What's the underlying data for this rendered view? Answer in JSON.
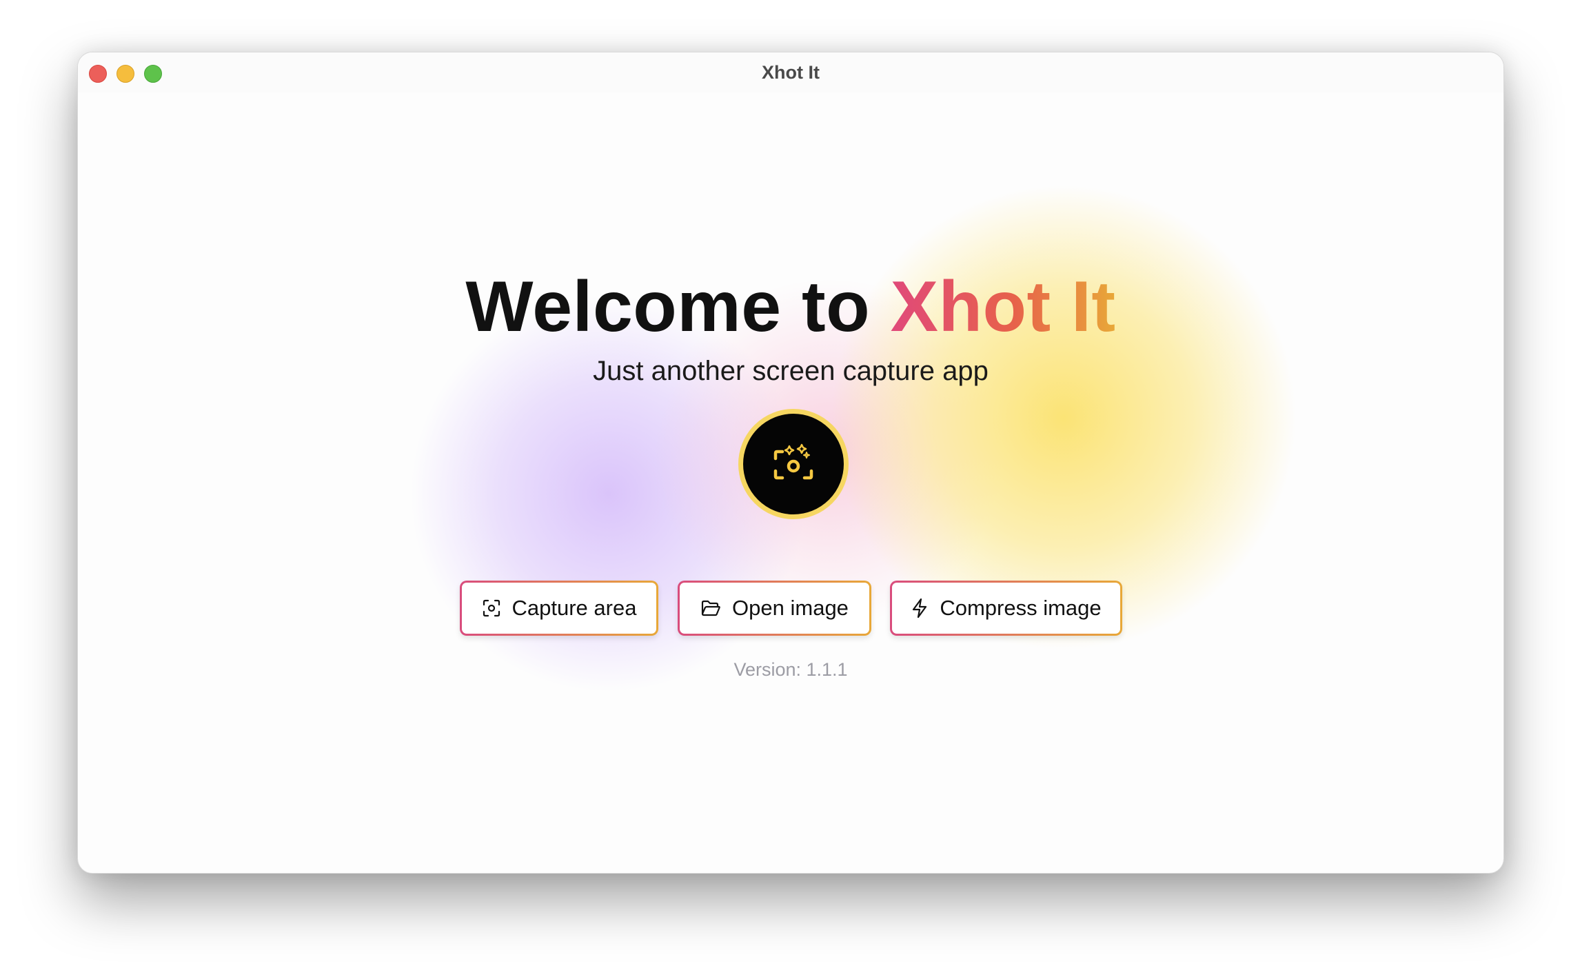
{
  "window": {
    "title": "Xhot It"
  },
  "hero": {
    "headline_prefix": "Welcome to",
    "headline_brand": "Xhot It",
    "subtitle": "Just another screen capture app",
    "logo_icon": "sparkle-camera-icon"
  },
  "actions": [
    {
      "label": "Capture area",
      "icon": "capture-area-icon"
    },
    {
      "label": "Open image",
      "icon": "folder-open-icon"
    },
    {
      "label": "Compress image",
      "icon": "lightning-icon"
    }
  ],
  "footer": {
    "version": "Version: 1.1.1"
  },
  "colors": {
    "brand_gradient_start": "#e0497a",
    "brand_gradient_end": "#e8a838",
    "logo_ring": "#f6d661",
    "logo_bg": "#050505",
    "blob_purple": "#d4bafa",
    "blob_pink": "#f6b8d0",
    "blob_yellow": "#fbe26e"
  }
}
